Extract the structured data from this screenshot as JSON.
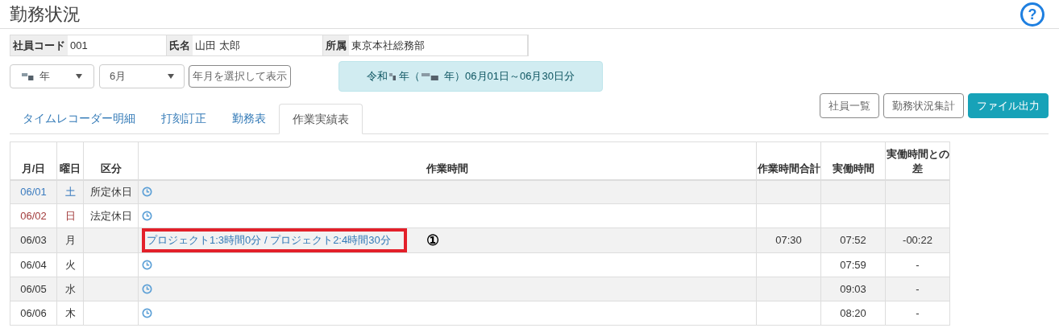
{
  "page": {
    "title": "勤務状況",
    "help": "?"
  },
  "employee": [
    {
      "label": "社員コード",
      "value": "001"
    },
    {
      "label": "氏名",
      "value": "山田 太郎"
    },
    {
      "label": "所属",
      "value": "東京本社総務部"
    }
  ],
  "filters": {
    "year": "年",
    "month": "6月",
    "show_button": "年月を選択して表示"
  },
  "period": {
    "era": "令和",
    "year_open": "年（",
    "rest": "年）06月01日～06月30日分"
  },
  "tabs": [
    {
      "label": "タイムレコーダー明細",
      "selected": false
    },
    {
      "label": "打刻訂正",
      "selected": false
    },
    {
      "label": "勤務表",
      "selected": false
    },
    {
      "label": "作業実績表",
      "selected": true
    }
  ],
  "actions": [
    {
      "label": "社員一覧",
      "kind": "outline"
    },
    {
      "label": "勤務状況集計",
      "kind": "outline"
    },
    {
      "label": "ファイル出力",
      "kind": "primary"
    }
  ],
  "table": {
    "columns": [
      "月/日",
      "曜日",
      "区分",
      "作業時間",
      "作業時間合計",
      "実働時間",
      "実働時間との差"
    ],
    "rows": [
      {
        "date": "06/01",
        "weekday": "土",
        "category": "所定休日",
        "color": "#3a7bbf",
        "highlighted": false
      },
      {
        "date": "06/02",
        "weekday": "日",
        "category": "法定休日",
        "color": "#a23b3b",
        "highlighted": false
      },
      {
        "date": "06/03",
        "weekday": "月",
        "work": "プロジェクト1:3時間0分 / プロジェクト2:4時間30分",
        "total": "07:30",
        "actual": "07:52",
        "diff": "-00:22",
        "color": "#333333",
        "highlighted": true,
        "annotation": "①"
      },
      {
        "date": "06/04",
        "weekday": "火",
        "actual": "07:59",
        "diff": "-",
        "color": "#333333",
        "highlighted": false
      },
      {
        "date": "06/05",
        "weekday": "水",
        "actual": "09:03",
        "diff": "-",
        "color": "#333333",
        "highlighted": false
      },
      {
        "date": "06/06",
        "weekday": "木",
        "actual": "08:20",
        "diff": "-",
        "color": "#333333",
        "highlighted": false
      }
    ]
  }
}
